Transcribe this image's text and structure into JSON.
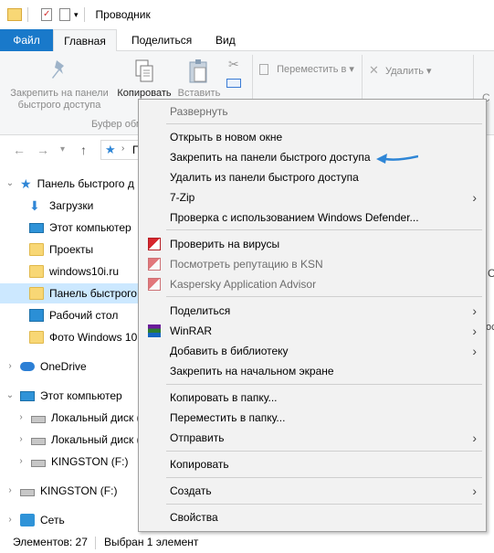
{
  "window": {
    "title": "Проводник"
  },
  "ribbon_tabs": {
    "file": "Файл",
    "home": "Главная",
    "share": "Поделиться",
    "view": "Вид"
  },
  "ribbon": {
    "pin_label": "Закрепить на панели быстрого доступа",
    "copy_label": "Копировать",
    "paste_label": "Вставить",
    "clipboard_group": "Буфер обм",
    "move_to": "Переместить в",
    "delete": "Удалить",
    "frag_rename": "С"
  },
  "address": {
    "path_frag": "П"
  },
  "nav": {
    "quick_access": "Панель быстрого д",
    "downloads": "Загрузки",
    "this_pc_pinned": "Этот компьютер",
    "projects": "Проекты",
    "windows10i": "windows10i.ru",
    "quick_panel": "Панель быстрого",
    "desktop": "Рабочий стол",
    "photos": "Фото Windows 10",
    "onedrive": "OneDrive",
    "this_pc": "Этот компьютер",
    "disk1": "Локальный диск (",
    "disk2": "Локальный диск (",
    "kingston_sub": "KINGSTON (F:)",
    "kingston": "KINGSTON (F:)",
    "network": "Сеть"
  },
  "right_fragments": {
    "a": "С",
    "b": "ос"
  },
  "status": {
    "count": "Элементов: 27",
    "selected": "Выбран 1 элемент"
  },
  "context_menu": {
    "expand": "Развернуть",
    "open_new_window": "Открыть в новом окне",
    "pin_quick_access": "Закрепить на панели быстрого доступа",
    "remove_quick_access": "Удалить из панели быстрого доступа",
    "seven_zip": "7-Zip",
    "defender": "Проверка с использованием Windows Defender...",
    "scan_virus": "Проверить на вирусы",
    "ksn": "Посмотреть репутацию в KSN",
    "kaspersky_advisor": "Kaspersky Application Advisor",
    "share": "Поделиться",
    "winrar": "WinRAR",
    "add_library": "Добавить в библиотеку",
    "pin_start": "Закрепить на начальном экране",
    "copy_to": "Копировать в папку...",
    "move_to": "Переместить в папку...",
    "send_to": "Отправить",
    "copy": "Копировать",
    "create": "Создать",
    "properties": "Свойства"
  },
  "colors": {
    "accent": "#1979ca",
    "selection": "#cce8ff",
    "menu_bg": "#f2f2f2",
    "arrow": "#2f86d6"
  }
}
